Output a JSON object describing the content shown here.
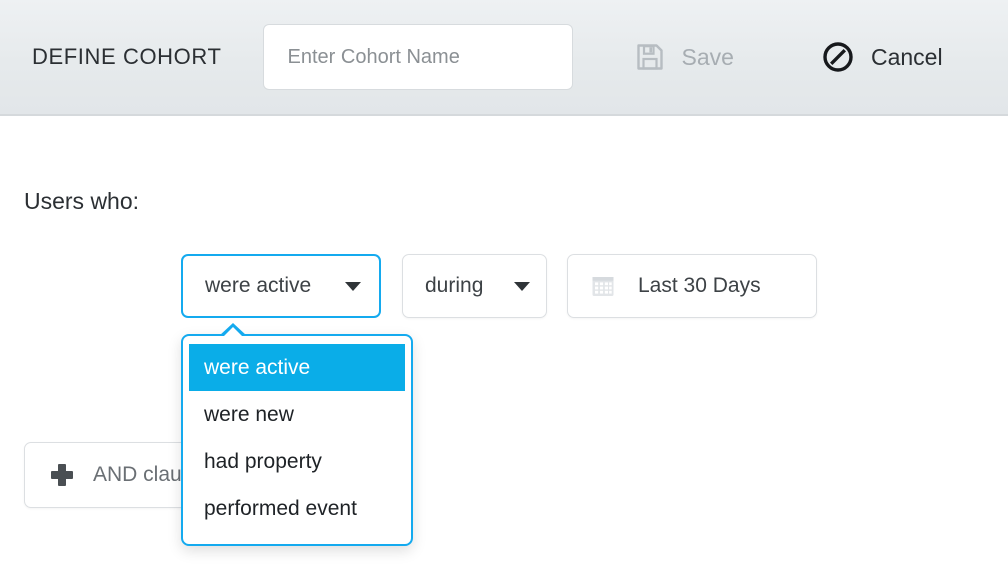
{
  "header": {
    "title": "DEFINE COHORT",
    "cohort_name_input": {
      "value": "",
      "placeholder": "Enter Cohort Name"
    },
    "save_label": "Save",
    "save_icon": "floppy-disk-icon",
    "cancel_label": "Cancel",
    "cancel_icon": "prohibition-icon"
  },
  "main": {
    "users_who_label": "Users who:",
    "verb_select": {
      "value": "were active",
      "options": [
        "were active",
        "were new",
        "had property",
        "performed event"
      ],
      "selected_index": 0,
      "open": true
    },
    "during_select": {
      "value": "during"
    },
    "date_field": {
      "value": "Last 30 Days",
      "icon": "calendar-icon"
    },
    "and_clause_button": {
      "label": "AND clause",
      "icon": "plus-icon"
    }
  },
  "colors": {
    "accent_blue": "#0aade8",
    "accent_border": "#14aaef",
    "header_bg": "#e6eaec",
    "text_dark": "#2b2f33",
    "text_muted": "#8b9094"
  }
}
